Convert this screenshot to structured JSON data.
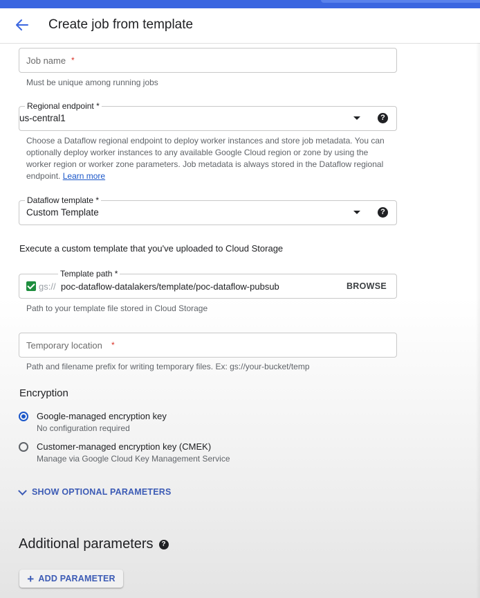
{
  "header": {
    "title": "Create job from template"
  },
  "job_name": {
    "placeholder": "Job name",
    "required_mark": "*",
    "hint": "Must be unique among running jobs"
  },
  "regional_endpoint": {
    "label": "Regional endpoint",
    "required_mark": "*",
    "value": "us-central1",
    "hint": "Choose a Dataflow regional endpoint to deploy worker instances and store job metadata. You can optionally deploy worker instances to any available Google Cloud region or zone by using the worker region or worker zone parameters. Job metadata is always stored in the Dataflow regional endpoint.",
    "learn_more": "Learn more"
  },
  "dataflow_template": {
    "label": "Dataflow template",
    "required_mark": "*",
    "value": "Custom Template"
  },
  "custom_template_text": "Execute a custom template that you've uploaded to Cloud Storage",
  "template_path": {
    "label": "Template path",
    "required_mark": "*",
    "prefix": "gs://",
    "value": "poc-dataflow-datalakers/template/poc-dataflow-pubsub",
    "browse": "BROWSE",
    "hint": "Path to your template file stored in Cloud Storage"
  },
  "temp_location": {
    "placeholder": "Temporary location",
    "required_mark": "*",
    "hint": "Path and filename prefix for writing temporary files. Ex: gs://your-bucket/temp"
  },
  "encryption": {
    "title": "Encryption",
    "options": [
      {
        "label": "Google-managed encryption key",
        "sub": "No configuration required",
        "selected": true
      },
      {
        "label": "Customer-managed encryption key (CMEK)",
        "sub": "Manage via Google Cloud Key Management Service",
        "selected": false
      }
    ]
  },
  "show_optional": "SHOW OPTIONAL PARAMETERS",
  "additional": {
    "title": "Additional parameters",
    "add_button": "ADD PARAMETER"
  },
  "icons": {
    "help": "?",
    "plus": "+"
  },
  "colors": {
    "accent": "#1a56c9",
    "topbar": "#3b66e0",
    "required": "#d93025",
    "checkbox": "#1e8e3e"
  }
}
